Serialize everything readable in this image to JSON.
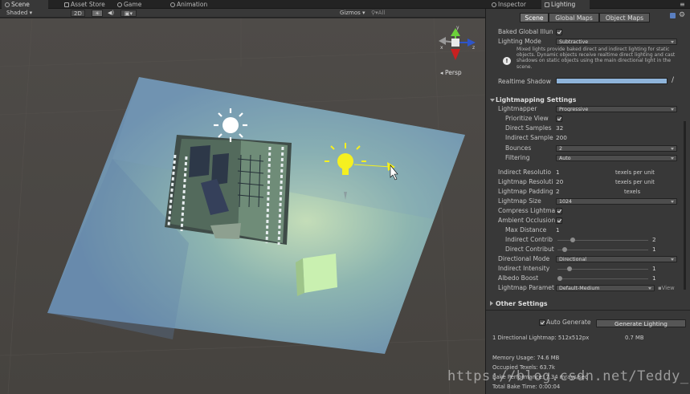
{
  "window": {
    "tabs": {
      "scene": "Scene",
      "asset_store": "Asset Store",
      "game": "Game",
      "animation": "Animation",
      "inspector": "Inspector",
      "lighting": "Lighting"
    }
  },
  "scene_toolbar": {
    "shaded": "Shaded",
    "mode_2d": "2D",
    "gizmos": "Gizmos",
    "search_all": "All"
  },
  "gizmo": {
    "persp": "Persp",
    "x": "x",
    "y": "y",
    "z": "z"
  },
  "lighting": {
    "subtabs": {
      "scene": "Scene",
      "global_maps": "Global Maps",
      "object_maps": "Object Maps"
    },
    "baked_gi": "Baked Global Illun",
    "lighting_mode_label": "Lighting Mode",
    "lighting_mode_value": "Subtractive",
    "info_text": "Mixed lights provide baked direct and indirect lighting for static objects. Dynamic objects receive realtime direct lighting and cast shadows on static objects using the main directional light in the scene.",
    "realtime_shadow": "Realtime Shadow",
    "lightmapping_header": "Lightmapping Settings",
    "lightmapper_label": "Lightmapper",
    "lightmapper_value": "Progressive",
    "prioritize_view": "Prioritize View",
    "direct_samples_label": "Direct Samples",
    "direct_samples_value": "32",
    "indirect_samples_label": "Indirect Sample",
    "indirect_samples_value": "200",
    "bounces_label": "Bounces",
    "bounces_value": "2",
    "filtering_label": "Filtering",
    "filtering_value": "Auto",
    "indirect_res_label": "Indirect Resolutio",
    "indirect_res_value": "1",
    "indirect_res_unit": "texels per unit",
    "lightmap_res_label": "Lightmap Resoluti",
    "lightmap_res_value": "20",
    "lightmap_res_unit": "texels per unit",
    "lightmap_padding_label": "Lightmap Padding",
    "lightmap_padding_value": "2",
    "lightmap_padding_unit": "texels",
    "lightmap_size_label": "Lightmap Size",
    "lightmap_size_value": "1024",
    "compress_label": "Compress Lightma",
    "ao_label": "Ambient Occlusion",
    "max_distance_label": "Max Distance",
    "max_distance_value": "1",
    "indirect_contrib_label": "Indirect Contrib",
    "indirect_contrib_value": "2",
    "direct_contrib_label": "Direct Contribut",
    "direct_contrib_value": "1",
    "directional_mode_label": "Directional Mode",
    "directional_mode_value": "Directional",
    "indirect_intensity_label": "Indirect Intensity",
    "indirect_intensity_value": "1",
    "albedo_boost_label": "Albedo Boost",
    "albedo_boost_value": "1",
    "params_label": "Lightmap Paramet",
    "params_value": "Default-Medium",
    "params_view": "View",
    "other_settings": "Other Settings",
    "auto_generate": "Auto Generate",
    "generate_button": "Generate Lighting",
    "lightmap_info": "1 Directional Lightmap: 512x512px",
    "lightmap_mb": "0.7 MB",
    "memory_usage": "Memory Usage: 74.6 MB",
    "occupied_texels": "Occupied Texels: 63.7k",
    "bake_performance": "Bake Performance: 7.34 mrays/sec",
    "total_bake_time": "Total Bake Time: 0:00:04"
  },
  "watermark": "https://blog.csdn.net/Teddy_k",
  "colors": {
    "panel": "#383838",
    "accent_light": "#f5f020",
    "ground": "#7fb0b8"
  }
}
